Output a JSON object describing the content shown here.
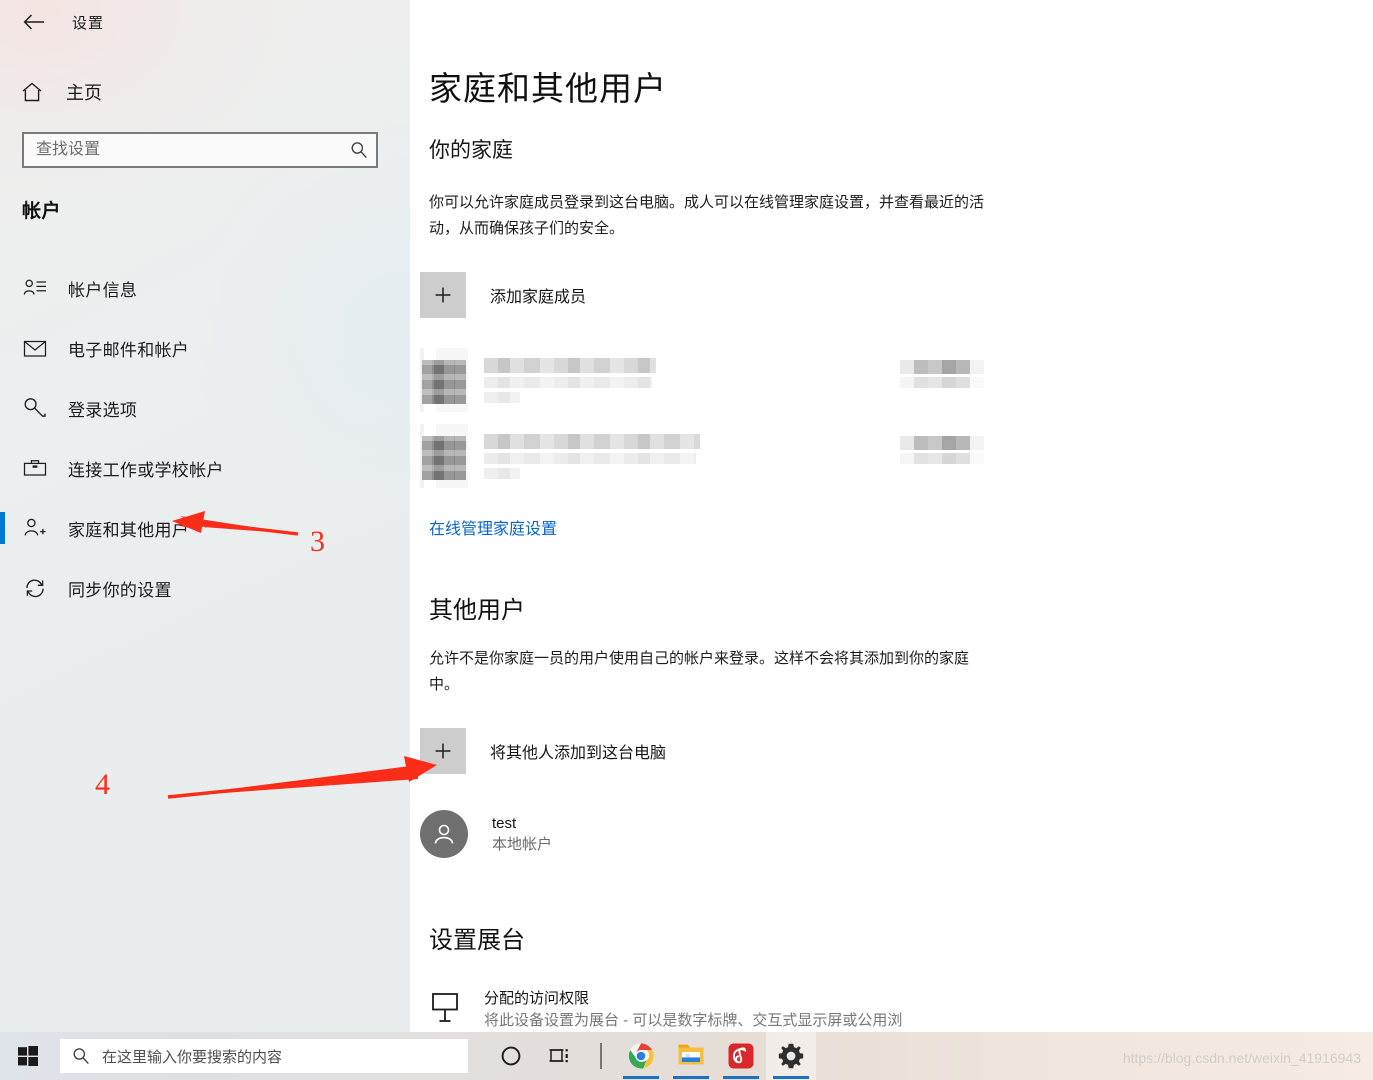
{
  "window": {
    "title": "设置",
    "back_icon": "back-arrow-icon"
  },
  "sidebar": {
    "home_label": "主页",
    "home_icon": "home-icon",
    "search": {
      "placeholder": "查找设置",
      "value": "",
      "icon": "search-icon"
    },
    "category": "帐户",
    "accent_color": "#0078d4",
    "items": [
      {
        "label": "帐户信息",
        "icon": "person-list-icon",
        "selected": false
      },
      {
        "label": "电子邮件和帐户",
        "icon": "envelope-icon",
        "selected": false
      },
      {
        "label": "登录选项",
        "icon": "key-icon",
        "selected": false
      },
      {
        "label": "连接工作或学校帐户",
        "icon": "briefcase-icon",
        "selected": false
      },
      {
        "label": "家庭和其他用户",
        "icon": "person-add-icon",
        "selected": true
      },
      {
        "label": "同步你的设置",
        "icon": "sync-icon",
        "selected": false
      }
    ]
  },
  "main": {
    "page_title": "家庭和其他用户",
    "family": {
      "heading": "你的家庭",
      "description": "你可以允许家庭成员登录到这台电脑。成人可以在线管理家庭设置，并查看最近的活动，从而确保孩子们的安全。",
      "add_label": "添加家庭成员",
      "add_icon": "plus-icon",
      "members_redacted": [
        {
          "avatar": "redacted-avatar",
          "name": "[已打码]",
          "status": "[已打码]"
        },
        {
          "avatar": "redacted-avatar",
          "name": "[已打码]",
          "status": "[已打码]"
        }
      ],
      "manage_link": "在线管理家庭设置",
      "link_color": "#0866c6"
    },
    "other_users": {
      "heading": "其他用户",
      "description": "允许不是你家庭一员的用户使用自己的帐户来登录。这样不会将其添加到你的家庭中。",
      "add_label": "将其他人添加到这台电脑",
      "add_icon": "plus-icon",
      "users": [
        {
          "name": "test",
          "type": "本地帐户",
          "avatar": "person-avatar-icon"
        }
      ]
    },
    "kiosk": {
      "heading": "设置展台",
      "icon": "kiosk-sign-icon",
      "title": "分配的访问权限",
      "description": "将此设备设置为展台 - 可以是数字标牌、交互式显示屏或公用浏"
    }
  },
  "annotations": {
    "color": "#fc2d18",
    "markers": [
      {
        "label": "3",
        "target": "sidebar-item-family-and-other-users"
      },
      {
        "label": "4",
        "target": "add-other-person-button"
      }
    ]
  },
  "taskbar": {
    "start_icon": "windows-start-icon",
    "search": {
      "placeholder": "在这里输入你要搜索的内容",
      "icon": "search-icon"
    },
    "buttons": [
      {
        "name": "cortana-icon",
        "running": false
      },
      {
        "name": "task-view-icon",
        "running": false
      }
    ],
    "apps": [
      {
        "name": "chrome-icon",
        "running": true
      },
      {
        "name": "file-explorer-icon",
        "running": true
      },
      {
        "name": "netease-music-icon",
        "running": true
      },
      {
        "name": "settings-gear-icon",
        "running": true,
        "active": true
      }
    ]
  },
  "watermark": "https://blog.csdn.net/weixin_41916943"
}
